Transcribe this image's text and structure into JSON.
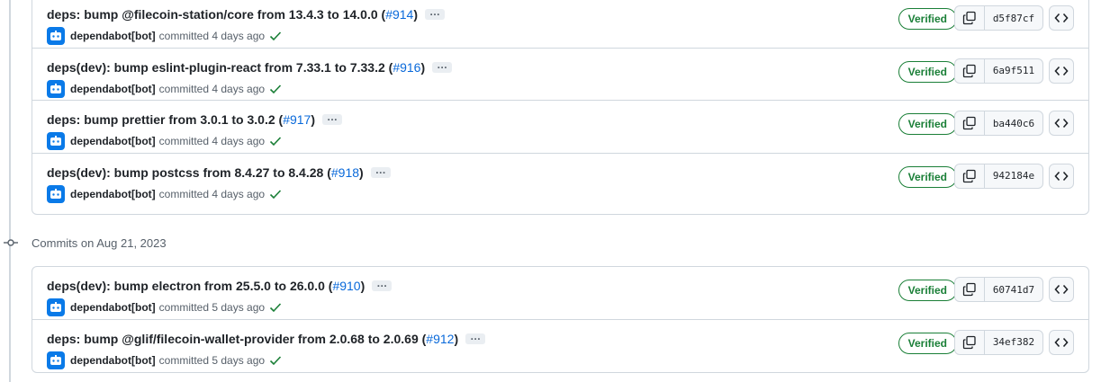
{
  "verified_label": "Verified",
  "date_header": "Commits on Aug 21, 2023",
  "groups": [
    {
      "commits": [
        {
          "title": "deps: bump @filecoin-station/core from 13.4.3 to 14.0.0",
          "pr": "#914",
          "author": "dependabot[bot]",
          "time": "committed 4 days ago",
          "sha": "d5f87cf"
        },
        {
          "title": "deps(dev): bump eslint-plugin-react from 7.33.1 to 7.33.2",
          "pr": "#916",
          "author": "dependabot[bot]",
          "time": "committed 4 days ago",
          "sha": "6a9f511"
        },
        {
          "title": "deps: bump prettier from 3.0.1 to 3.0.2",
          "pr": "#917",
          "author": "dependabot[bot]",
          "time": "committed 4 days ago",
          "sha": "ba440c6"
        },
        {
          "title": "deps(dev): bump postcss from 8.4.27 to 8.4.28",
          "pr": "#918",
          "author": "dependabot[bot]",
          "time": "committed 4 days ago",
          "sha": "942184e"
        }
      ]
    },
    {
      "commits": [
        {
          "title": "deps(dev): bump electron from 25.5.0 to 26.0.0",
          "pr": "#910",
          "author": "dependabot[bot]",
          "time": "committed 5 days ago",
          "sha": "60741d7"
        },
        {
          "title": "deps: bump @glif/filecoin-wallet-provider from 2.0.68 to 2.0.69",
          "pr": "#912",
          "author": "dependabot[bot]",
          "time": "committed 5 days ago",
          "sha": "34ef382"
        }
      ]
    }
  ],
  "colors": {
    "verified": "#1a7f37",
    "link": "#0969da",
    "avatar": "#0a7ae8"
  },
  "icons": {
    "copy": "copy-icon",
    "browse": "code-icon",
    "check": "check-icon",
    "node": "git-commit-icon",
    "avatar": "dependabot-icon"
  }
}
